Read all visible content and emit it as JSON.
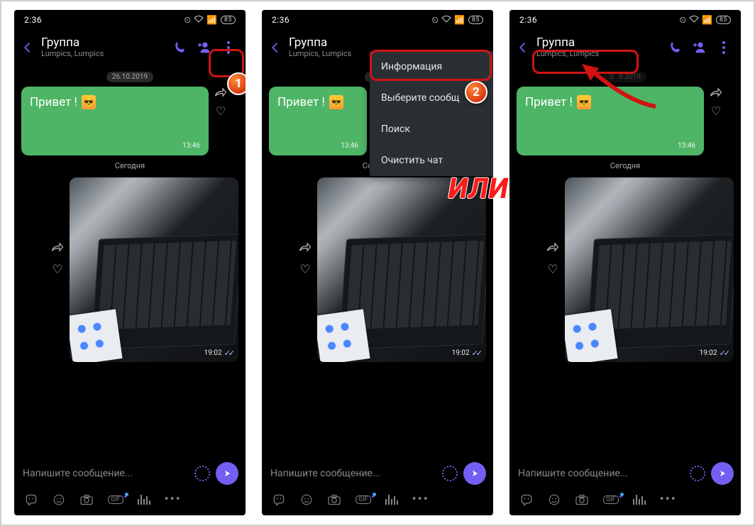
{
  "status": {
    "time": "2:36",
    "battery": "85"
  },
  "header": {
    "title": "Группа",
    "subtitle": "Lumpics, Lumpics"
  },
  "chat": {
    "date_pill": "26.10.2019",
    "msg1_text": "Привет !",
    "msg1_time": "13:46",
    "today_label": "Сегодня",
    "photo_time": "19:02"
  },
  "input": {
    "placeholder": "Напишите сообщение..."
  },
  "toolbar": {
    "gif": "GIF"
  },
  "menu": {
    "info": "Информация",
    "select": "Выберите сообщ",
    "search": "Поиск",
    "clear": "Очистить чат"
  },
  "annot": {
    "num1": "1",
    "num2": "2",
    "or": "ИЛИ"
  }
}
